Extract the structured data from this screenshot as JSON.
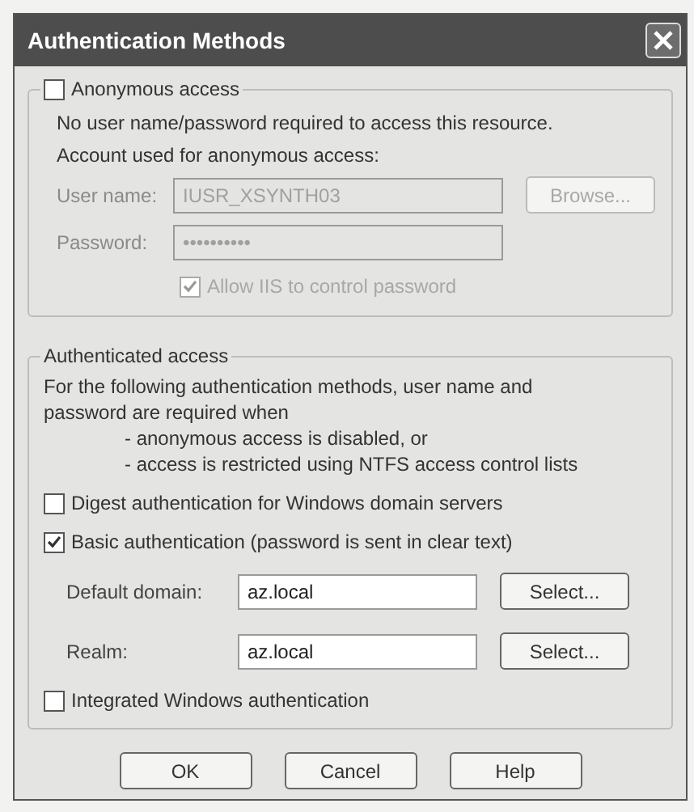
{
  "window": {
    "title": "Authentication Methods"
  },
  "anonymous": {
    "label": "Anonymous access",
    "checked": false,
    "description": "No user name/password required to access this resource.",
    "account_label": "Account used for anonymous access:",
    "fields": [
      {
        "label": "User name:",
        "value": "IUSR_XSYNTH03",
        "disabled": true,
        "button": "Browse..."
      },
      {
        "label": "Password:",
        "value": "••••••••••",
        "disabled": true
      }
    ],
    "allow": {
      "label": "Allow IIS to control password",
      "checked": true,
      "disabled": true
    }
  },
  "authenticated": {
    "title": "Authenticated access",
    "intro": "For the following authentication methods, user name and password are required when",
    "conditions": [
      "- anonymous access is disabled, or",
      "- access is restricted using NTFS access control lists"
    ],
    "items": [
      {
        "kind": "checkbox",
        "label": "Digest authentication for Windows domain servers",
        "checked": false
      },
      {
        "kind": "checkbox",
        "label": "Basic authentication (password is sent in clear text)",
        "checked": true
      },
      {
        "kind": "field",
        "label": "Default domain:",
        "value": "az.local",
        "button": "Select..."
      },
      {
        "kind": "field",
        "label": "Realm:",
        "value": "az.local",
        "button": "Select..."
      },
      {
        "kind": "checkbox",
        "label": "Integrated Windows authentication",
        "checked": false
      }
    ]
  },
  "buttons": [
    "OK",
    "Cancel",
    "Help"
  ]
}
